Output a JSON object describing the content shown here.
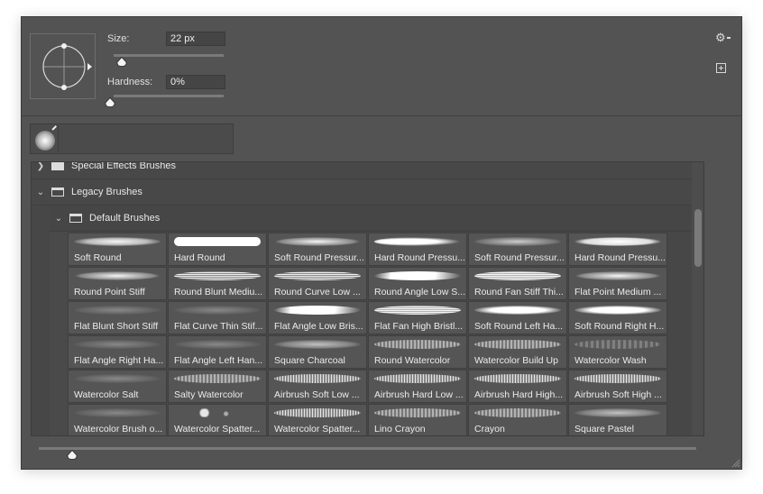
{
  "brush_settings": {
    "size_label": "Size:",
    "size_value": "22 px",
    "size_slider_fraction": 0.04,
    "hardness_label": "Hardness:",
    "hardness_value": "0%",
    "hardness_slider_fraction": 0.0,
    "angle_preview_icon": "brush-tip-angle-roundness-icon"
  },
  "toolbar": {
    "settings_icon": "gear-icon",
    "new_brush_icon": "new-brush-plus-icon"
  },
  "recent_brushes": [
    {
      "icon": "soft-round-brush-icon"
    }
  ],
  "groups": [
    {
      "label": "Special Effects Brushes",
      "expanded": false
    },
    {
      "label": "Legacy Brushes",
      "expanded": true
    },
    {
      "label": "Default Brushes",
      "expanded": true
    }
  ],
  "brushes": [
    "Soft Round",
    "Hard Round",
    "Soft Round Pressur...",
    "Hard Round Pressu...",
    "Soft Round Pressur...",
    "Hard Round Pressu...",
    "Round Point Stiff",
    "Round Blunt Mediu...",
    "Round Curve Low ...",
    "Round Angle Low S...",
    "Round Fan Stiff Thi...",
    "Flat Point Medium ...",
    "Flat Blunt Short Stiff",
    "Flat Curve Thin Stif...",
    "Flat Angle Low Bris...",
    "Flat Fan High Bristl...",
    "Soft Round Left Ha...",
    "Soft Round Right H...",
    "Flat Angle Right Ha...",
    "Flat Angle Left Han...",
    "Square Charcoal",
    "Round Watercolor",
    "Watercolor Build Up",
    "Watercolor Wash",
    "Watercolor Salt",
    "Salty Watercolor",
    "Airbrush Soft Low ...",
    "Airbrush Hard Low ...",
    "Airbrush Hard High...",
    "Airbrush Soft High ...",
    "Watercolor Brush o...",
    "Watercolor Spatter...",
    "Watercolor Spatter...",
    "Lino Crayon",
    "Crayon",
    "Square Pastel"
  ],
  "preview_size_slider_fraction": 0.05,
  "colors": {
    "panel_bg": "#535353",
    "list_bg": "#474747",
    "text": "#e8e8e8"
  }
}
